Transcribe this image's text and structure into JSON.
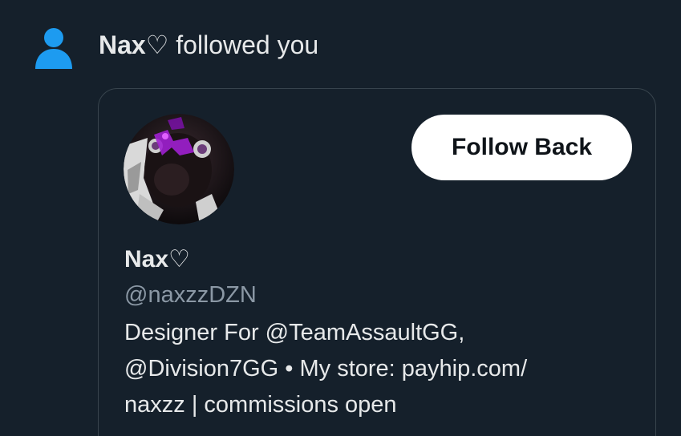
{
  "notification": {
    "actor_name": "Nax♡",
    "action_text": " followed you",
    "icon": "person-icon",
    "icon_color": "#1d9bf0"
  },
  "profile": {
    "display_name": "Nax♡",
    "handle": "@naxzzDZN",
    "bio_lines": [
      "Designer For @TeamAssaultGG,",
      "@Division7GG • My store: payhip.com/",
      "naxzz | commissions open"
    ]
  },
  "actions": {
    "follow_back_label": "Follow Back"
  },
  "colors": {
    "background": "#15202b",
    "card_border": "#38444d",
    "secondary_text": "#8b98a5",
    "button_bg": "#ffffff"
  }
}
